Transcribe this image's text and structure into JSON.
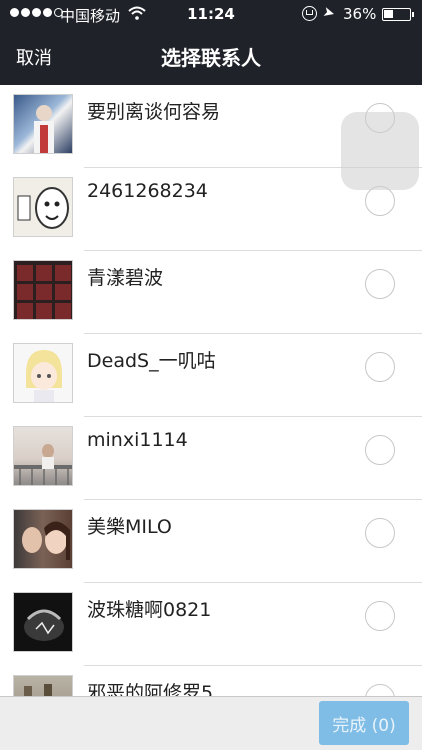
{
  "status_bar": {
    "carrier": "中国移动",
    "time": "11:24",
    "battery": "36%"
  },
  "nav": {
    "cancel": "取消",
    "title": "选择联系人"
  },
  "contacts": [
    {
      "name": "要别离谈何容易",
      "avatar": "anime-character-avatar"
    },
    {
      "name": "2461268234",
      "avatar": "manga-face-avatar"
    },
    {
      "name": "青漾碧波",
      "avatar": "photo-grid-avatar"
    },
    {
      "name": "DeadS_一叽咕",
      "avatar": "anime-girl-avatar"
    },
    {
      "name": "minxi1114",
      "avatar": "balcony-photo-avatar"
    },
    {
      "name": "美樂MILO",
      "avatar": "couple-photo-avatar"
    },
    {
      "name": "波珠糖啊0821",
      "avatar": "dark-photo-avatar"
    },
    {
      "name": "邪恶的阿修罗5",
      "avatar": "street-photo-avatar"
    }
  ],
  "footer": {
    "done_label": "完成 (0)"
  },
  "colors": {
    "nav_bg": "#1f2329",
    "done_bg": "#7fbde6"
  }
}
